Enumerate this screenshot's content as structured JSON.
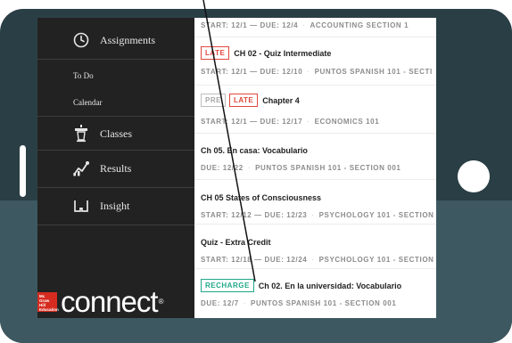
{
  "sidebar": {
    "items": [
      {
        "label": "Assignments",
        "icon": "clock-icon"
      },
      {
        "label": "To Do"
      },
      {
        "label": "Calendar"
      },
      {
        "label": "Classes",
        "icon": "podium-icon"
      },
      {
        "label": "Results",
        "icon": "chart-line-icon"
      },
      {
        "label": "Insight",
        "icon": "glasses-icon"
      }
    ],
    "logo": {
      "brand_lines": [
        "Mc",
        "Graw",
        "Hill",
        "Education"
      ],
      "wordmark": "connect",
      "reg": "®"
    }
  },
  "assignments": [
    {
      "title": "",
      "badges": [],
      "meta": [
        "START: 12/1 — DUE: 12/4",
        "ACCOUNTING SECTION 1"
      ]
    },
    {
      "title": "CH 02 - Quiz Intermediate",
      "badges": [
        "LATE"
      ],
      "meta": [
        "START: 12/1 — DUE: 12/10",
        "PUNTOS SPANISH 101 - SECTI"
      ]
    },
    {
      "title": "Chapter 4",
      "badges": [
        "PRE",
        "LATE"
      ],
      "meta": [
        "START: 12/1 — DUE: 12/17",
        "ECONOMICS 101"
      ]
    },
    {
      "title": "Ch 05. En casa: Vocabulario",
      "badges": [],
      "meta": [
        "DUE: 12/22",
        "PUNTOS SPANISH 101 - SECTION 001"
      ]
    },
    {
      "title": "CH 05 States of Consciousness",
      "badges": [],
      "meta": [
        "START: 12/12 — DUE: 12/23",
        "PSYCHOLOGY 101 - SECTION"
      ]
    },
    {
      "title": "Quiz - Extra Credit",
      "badges": [],
      "meta": [
        "START: 12/18 — DUE: 12/24",
        "PSYCHOLOGY 101 - SECTION"
      ]
    },
    {
      "title": "Ch 02. En la universidad: Vocabulario",
      "badges": [
        "RECHARGE"
      ],
      "meta": [
        "DUE: 12/7",
        "PUNTOS SPANISH 101 - SECTION 001"
      ]
    }
  ],
  "colors": {
    "late": "#e0483b",
    "recharge": "#1fa889",
    "frame": "#2a3e45",
    "sidebar": "#222222"
  }
}
